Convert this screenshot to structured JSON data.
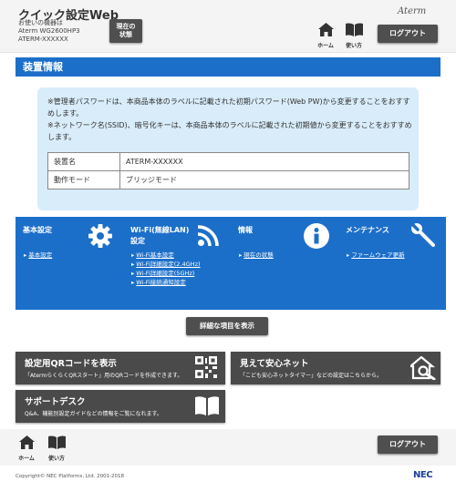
{
  "header": {
    "app_title": "クイック設定Web",
    "device_caption": "お使いの機器は",
    "device_model": "Aterm WG2600HP3",
    "device_name": "ATERM-XXXXXX",
    "status_button_line1": "現在の",
    "status_button_line2": "状態",
    "brand_logo": "Aterm",
    "home_label": "ホーム",
    "manual_label": "使い方",
    "logout_label": "ログアウト"
  },
  "section": {
    "title": "装置情報"
  },
  "notes": {
    "note1": "※管理者パスワードは、本商品本体のラベルに記載された初期パスワード(Web PW)から変更することをおすすめします。",
    "note2": "※ネットワーク名(SSID)、暗号化キーは、本商品本体のラベルに記載された初期値から変更することをおすすめします。"
  },
  "device_table": {
    "rows": [
      {
        "key": "装置名",
        "value": "ATERM-XXXXXX"
      },
      {
        "key": "動作モード",
        "value": "ブリッジモード"
      }
    ]
  },
  "tiles": [
    {
      "title": "基本設定",
      "title2": "",
      "icon": "gear-icon",
      "links": [
        "基本設定"
      ]
    },
    {
      "title": "Wi-Fi(無線LAN)",
      "title2": "設定",
      "icon": "wifi-icon",
      "links": [
        "Wi-Fi基本設定",
        "Wi-Fi詳細設定(2.4GHz)",
        "Wi-Fi詳細設定(5GHz)",
        "Wi-Fi接続通知設定"
      ]
    },
    {
      "title": "情報",
      "title2": "",
      "icon": "info-icon",
      "links": [
        "現在の状態"
      ]
    },
    {
      "title": "メンテナンス",
      "title2": "",
      "icon": "wrench-icon",
      "links": [
        "ファームウェア更新"
      ]
    }
  ],
  "detail_button": "詳細な項目を表示",
  "qr_panel": {
    "title": "設定用QRコードを表示",
    "desc": "「AtermらくらくQRスタート」用のQRコードを作成できます。",
    "icon": "qr-code-icon"
  },
  "safe_panel": {
    "title": "見えて安心ネット",
    "desc": "「こども安心ネットタイマー」などの設定はこちらから。",
    "icon": "home-search-icon"
  },
  "support_panel": {
    "title": "サポートデスク",
    "desc": "Q&A、機能別設定ガイドなどの情報をご覧になれます。",
    "icon": "book-icon"
  },
  "footer": {
    "home_label": "ホーム",
    "manual_label": "使い方",
    "logout_label": "ログアウト",
    "copyright": "Copyright© NEC Platforms, Ltd. 2001-2018",
    "nec_logo": "NEC"
  },
  "colors": {
    "accent_blue": "#1c6fc9",
    "panel_blue": "#d8ecf9",
    "button_dark": "#4f4f4f"
  }
}
